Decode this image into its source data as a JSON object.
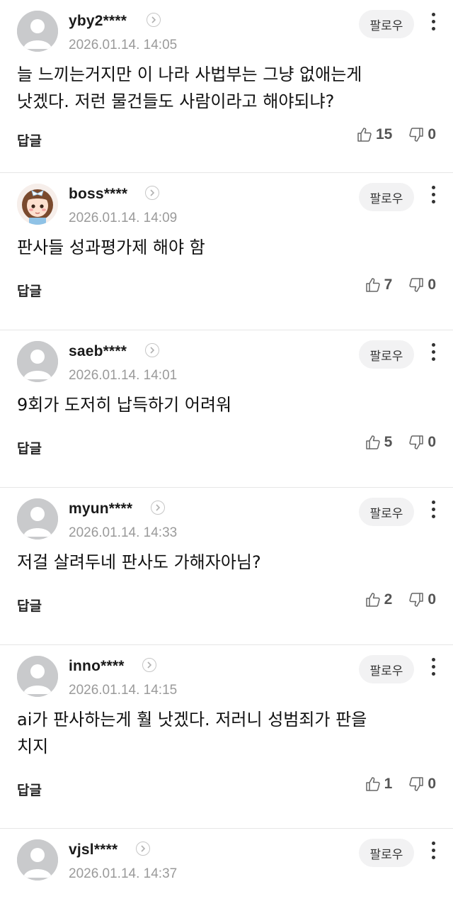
{
  "comments": [
    {
      "nickname": "yby2****",
      "date": "2026.01.14. 14:05",
      "text": "늘 느끼는거지만 이 나라 사법부는 그냥 없애는게\n낫겠다. 저런 물건들도 사람이라고 해야되냐?",
      "follow_label": "팔로우",
      "reply_label": "답글",
      "likes": "15",
      "dislikes": "0",
      "avatar": "default"
    },
    {
      "nickname": "boss****",
      "date": "2026.01.14. 14:09",
      "text": "판사들 성과평가제 해야 함",
      "follow_label": "팔로우",
      "reply_label": "답글",
      "likes": "7",
      "dislikes": "0",
      "avatar": "character"
    },
    {
      "nickname": "saeb****",
      "date": "2026.01.14. 14:01",
      "text": "9회가 도저히 납득하기 어려워",
      "follow_label": "팔로우",
      "reply_label": "답글",
      "likes": "5",
      "dislikes": "0",
      "avatar": "default"
    },
    {
      "nickname": "myun****",
      "date": "2026.01.14. 14:33",
      "text": "저걸 살려두네 판사도 가해자아님?",
      "follow_label": "팔로우",
      "reply_label": "답글",
      "likes": "2",
      "dislikes": "0",
      "avatar": "default"
    },
    {
      "nickname": "inno****",
      "date": "2026.01.14. 14:15",
      "text": "ai가 판사하는게 훨 낫겠다. 저러니 성범죄가 판을\n치지",
      "follow_label": "팔로우",
      "reply_label": "답글",
      "likes": "1",
      "dislikes": "0",
      "avatar": "default"
    },
    {
      "nickname": "vjsl****",
      "date": "2026.01.14. 14:37",
      "follow_label": "팔로우",
      "avatar": "default"
    }
  ],
  "icons": {
    "like": "thumbs-up-icon",
    "dislike": "thumbs-down-icon",
    "more": "more-vertical-icon",
    "profile_link": "chevron-right-icon"
  },
  "colors": {
    "follow_bg": "#f2f2f3",
    "date": "#9a9a9a",
    "divider": "#e6e6e6"
  }
}
